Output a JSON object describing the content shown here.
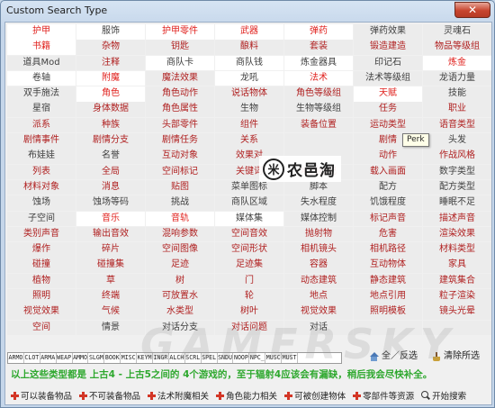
{
  "window": {
    "title": "Custom Search Type",
    "close_glyph": "✕"
  },
  "grid": [
    [
      {
        "t": "护甲",
        "c": "s"
      },
      {
        "t": "服饰",
        "c": "sg"
      },
      {
        "t": "护甲零件",
        "c": "s"
      },
      {
        "t": "武器",
        "c": "s"
      },
      {
        "t": "弹药",
        "c": "s"
      },
      {
        "t": "弹药效果",
        "c": "g"
      },
      {
        "t": "灵魂石",
        "c": "g"
      }
    ],
    [
      {
        "t": "书籍",
        "c": "s"
      },
      {
        "t": "杂物",
        "c": ""
      },
      {
        "t": "钥匙",
        "c": ""
      },
      {
        "t": "酿料",
        "c": ""
      },
      {
        "t": "套装",
        "c": ""
      },
      {
        "t": "锻造建造",
        "c": ""
      },
      {
        "t": "物品等级组",
        "c": ""
      }
    ],
    [
      {
        "t": "道具Mod",
        "c": "g"
      },
      {
        "t": "注释",
        "c": ""
      },
      {
        "t": "商队卡",
        "c": "sg"
      },
      {
        "t": "商队钱",
        "c": "sg"
      },
      {
        "t": "炼金器具",
        "c": "sg"
      },
      {
        "t": "印记石",
        "c": "g"
      },
      {
        "t": "炼金",
        "c": "s"
      }
    ],
    [
      {
        "t": "卷轴",
        "c": "sg"
      },
      {
        "t": "附魔",
        "c": "s"
      },
      {
        "t": "魔法效果",
        "c": ""
      },
      {
        "t": "龙吼",
        "c": "sg"
      },
      {
        "t": "法术",
        "c": "s"
      },
      {
        "t": "法术等级组",
        "c": "g"
      },
      {
        "t": "龙语力量",
        "c": "g"
      }
    ],
    [
      {
        "t": "双手施法",
        "c": "g"
      },
      {
        "t": "角色",
        "c": "s"
      },
      {
        "t": "角色动作",
        "c": ""
      },
      {
        "t": "说话物体",
        "c": ""
      },
      {
        "t": "角色等级组",
        "c": ""
      },
      {
        "t": "天赋",
        "c": "s"
      },
      {
        "t": "技能",
        "c": "g"
      }
    ],
    [
      {
        "t": "星宿",
        "c": "g"
      },
      {
        "t": "身体数据",
        "c": ""
      },
      {
        "t": "角色属性",
        "c": ""
      },
      {
        "t": "生物",
        "c": "g"
      },
      {
        "t": "生物等级组",
        "c": "g"
      },
      {
        "t": "任务",
        "c": ""
      },
      {
        "t": "职业",
        "c": ""
      }
    ],
    [
      {
        "t": "派系",
        "c": ""
      },
      {
        "t": "种族",
        "c": ""
      },
      {
        "t": "头部零件",
        "c": ""
      },
      {
        "t": "组件",
        "c": ""
      },
      {
        "t": "装备位置",
        "c": ""
      },
      {
        "t": "运动类型",
        "c": ""
      },
      {
        "t": "语音类型",
        "c": ""
      }
    ],
    [
      {
        "t": "剧情事件",
        "c": ""
      },
      {
        "t": "剧情分支",
        "c": ""
      },
      {
        "t": "剧情任务",
        "c": ""
      },
      {
        "t": "关系",
        "c": ""
      },
      {
        "t": "",
        "c": ""
      },
      {
        "t": "剧情",
        "c": ""
      },
      {
        "t": "头发",
        "c": "g"
      }
    ],
    [
      {
        "t": "布娃娃",
        "c": "g"
      },
      {
        "t": "名誉",
        "c": "g"
      },
      {
        "t": "互动对象",
        "c": ""
      },
      {
        "t": "效果对",
        "c": ""
      },
      {
        "t": "",
        "c": ""
      },
      {
        "t": "动作",
        "c": ""
      },
      {
        "t": "作战风格",
        "c": ""
      }
    ],
    [
      {
        "t": "列表",
        "c": ""
      },
      {
        "t": "全局",
        "c": ""
      },
      {
        "t": "空间标记",
        "c": ""
      },
      {
        "t": "关键词",
        "c": ""
      },
      {
        "t": "地图标记",
        "c": ""
      },
      {
        "t": "载入画面",
        "c": ""
      },
      {
        "t": "数字类型",
        "c": "g"
      }
    ],
    [
      {
        "t": "材料对象",
        "c": ""
      },
      {
        "t": "消息",
        "c": ""
      },
      {
        "t": "贴图",
        "c": ""
      },
      {
        "t": "菜单图标",
        "c": "g"
      },
      {
        "t": "脚本",
        "c": "g"
      },
      {
        "t": "配方",
        "c": "g"
      },
      {
        "t": "配方类型",
        "c": "g"
      }
    ],
    [
      {
        "t": "蚀场",
        "c": "g"
      },
      {
        "t": "蚀场等码",
        "c": "g"
      },
      {
        "t": "挑战",
        "c": "g"
      },
      {
        "t": "商队区域",
        "c": "g"
      },
      {
        "t": "失水程度",
        "c": "g"
      },
      {
        "t": "饥饿程度",
        "c": "g"
      },
      {
        "t": "睡眠不足",
        "c": "g"
      }
    ],
    [
      {
        "t": "子空间",
        "c": "g"
      },
      {
        "t": "音乐",
        "c": "s"
      },
      {
        "t": "音轨",
        "c": "s"
      },
      {
        "t": "媒体集",
        "c": "sg"
      },
      {
        "t": "媒体控制",
        "c": "g"
      },
      {
        "t": "标记声音",
        "c": ""
      },
      {
        "t": "描述声音",
        "c": ""
      }
    ],
    [
      {
        "t": "类别声音",
        "c": ""
      },
      {
        "t": "输出音效",
        "c": ""
      },
      {
        "t": "混响参数",
        "c": ""
      },
      {
        "t": "空间音效",
        "c": ""
      },
      {
        "t": "抛射物",
        "c": ""
      },
      {
        "t": "危害",
        "c": ""
      },
      {
        "t": "渲染效果",
        "c": ""
      }
    ],
    [
      {
        "t": "爆作",
        "c": ""
      },
      {
        "t": "碎片",
        "c": ""
      },
      {
        "t": "空间图像",
        "c": ""
      },
      {
        "t": "空间形状",
        "c": ""
      },
      {
        "t": "相机镜头",
        "c": ""
      },
      {
        "t": "相机路径",
        "c": ""
      },
      {
        "t": "材料类型",
        "c": ""
      }
    ],
    [
      {
        "t": "碰撞",
        "c": ""
      },
      {
        "t": "碰撞集",
        "c": ""
      },
      {
        "t": "足迹",
        "c": ""
      },
      {
        "t": "足迹集",
        "c": ""
      },
      {
        "t": "容器",
        "c": ""
      },
      {
        "t": "互动物体",
        "c": ""
      },
      {
        "t": "家具",
        "c": ""
      }
    ],
    [
      {
        "t": "植物",
        "c": ""
      },
      {
        "t": "草",
        "c": ""
      },
      {
        "t": "树",
        "c": ""
      },
      {
        "t": "门",
        "c": ""
      },
      {
        "t": "动态建筑",
        "c": ""
      },
      {
        "t": "静态建筑",
        "c": ""
      },
      {
        "t": "建筑集合",
        "c": ""
      }
    ],
    [
      {
        "t": "照明",
        "c": ""
      },
      {
        "t": "终端",
        "c": ""
      },
      {
        "t": "可放置水",
        "c": ""
      },
      {
        "t": "轮",
        "c": ""
      },
      {
        "t": "地点",
        "c": ""
      },
      {
        "t": "地点引用",
        "c": ""
      },
      {
        "t": "粒子渲染",
        "c": ""
      }
    ],
    [
      {
        "t": "视觉效果",
        "c": ""
      },
      {
        "t": "气候",
        "c": ""
      },
      {
        "t": "水类型",
        "c": ""
      },
      {
        "t": "树叶",
        "c": ""
      },
      {
        "t": "视觉效果",
        "c": ""
      },
      {
        "t": "照明模板",
        "c": ""
      },
      {
        "t": "镜头光晕",
        "c": ""
      }
    ],
    [
      {
        "t": "空间",
        "c": ""
      },
      {
        "t": "情景",
        "c": "g"
      },
      {
        "t": "对话分支",
        "c": "g"
      },
      {
        "t": "对话问题",
        "c": ""
      },
      {
        "t": "对话",
        "c": "g"
      },
      {
        "t": "",
        "c": "g"
      },
      {
        "t": "",
        "c": "g"
      }
    ]
  ],
  "tooltip": "Perk",
  "watermark": {
    "logo_mark": "米",
    "logo_name": "农邑淘",
    "big": "GAMERSKY"
  },
  "type_codes": [
    "ARMO",
    "CLOT",
    "ARMA",
    "WEAP",
    "AMMO",
    "SLGM",
    "BOOK",
    "MISC",
    "KEYM",
    "INGR",
    "ALCH",
    "SCRL",
    "SPEL",
    "SNDU",
    "NOOP",
    "NPC_",
    "MUSC",
    "MUST"
  ],
  "actions": {
    "select_all": "全／反选",
    "clear": "清除所选"
  },
  "note": "以上这些类型都是 上古4 - 上古5之间的 4个游戏的，至于辐射4应该会有漏缺，稍后我会尽快补全。",
  "bottom_buttons": [
    "可以装备物品",
    "不可装备物品",
    "法术附魔相关",
    "角色能力相关",
    "可被创建物体",
    "零部件等资源"
  ],
  "search_button": "开始搜索"
}
